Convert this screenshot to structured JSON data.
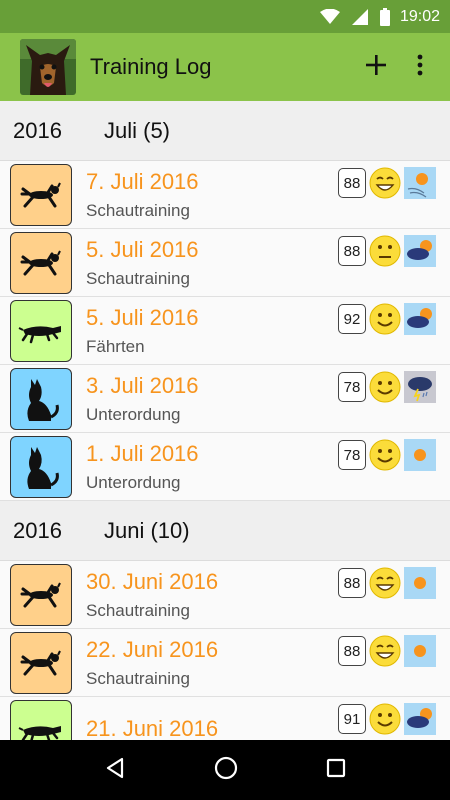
{
  "status_bar": {
    "time": "19:02"
  },
  "app_bar": {
    "title": "Training Log",
    "add_icon": "plus-icon",
    "menu_icon": "more-vert-icon"
  },
  "sections": [
    {
      "year": "2016",
      "month": "Juli (5)",
      "entries": [
        {
          "date": "7. Juli 2016",
          "type": "Schautraining",
          "score": "88",
          "category": "schautraining",
          "mood": "grin",
          "weather": "sunny-windy"
        },
        {
          "date": "5. Juli 2016",
          "type": "Schautraining",
          "score": "88",
          "category": "schautraining",
          "mood": "neutral",
          "weather": "cloudy-sun"
        },
        {
          "date": "5. Juli 2016",
          "type": "Fährten",
          "score": "92",
          "category": "faehrten",
          "mood": "smile",
          "weather": "cloudy-sun"
        },
        {
          "date": "3. Juli 2016",
          "type": "Unterordung",
          "score": "78",
          "category": "unterordnung",
          "mood": "smile",
          "weather": "storm"
        },
        {
          "date": "1. Juli 2016",
          "type": "Unterordung",
          "score": "78",
          "category": "unterordnung",
          "mood": "smile",
          "weather": "sunny"
        }
      ]
    },
    {
      "year": "2016",
      "month": "Juni (10)",
      "entries": [
        {
          "date": "30. Juni 2016",
          "type": "Schautraining",
          "score": "88",
          "category": "schautraining",
          "mood": "grin",
          "weather": "sunny"
        },
        {
          "date": "22. Juni 2016",
          "type": "Schautraining",
          "score": "88",
          "category": "schautraining",
          "mood": "grin",
          "weather": "sunny"
        },
        {
          "date": "21. Juni 2016",
          "type": "",
          "score": "91",
          "category": "faehrten",
          "mood": "smile",
          "weather": "cloudy-sun"
        }
      ]
    }
  ],
  "colors": {
    "status_bar": "#689f38",
    "app_bar": "#8bc34a",
    "date_text": "#f7941d",
    "schautraining_bg": "#ffd08a",
    "faehrten_bg": "#ccff90",
    "unterordnung_bg": "#7fd4ff",
    "weather_bg": "#a9d8f5"
  },
  "nav_bar": {
    "back_icon": "back-triangle-icon",
    "home_icon": "home-circle-icon",
    "recents_icon": "recents-square-icon"
  }
}
